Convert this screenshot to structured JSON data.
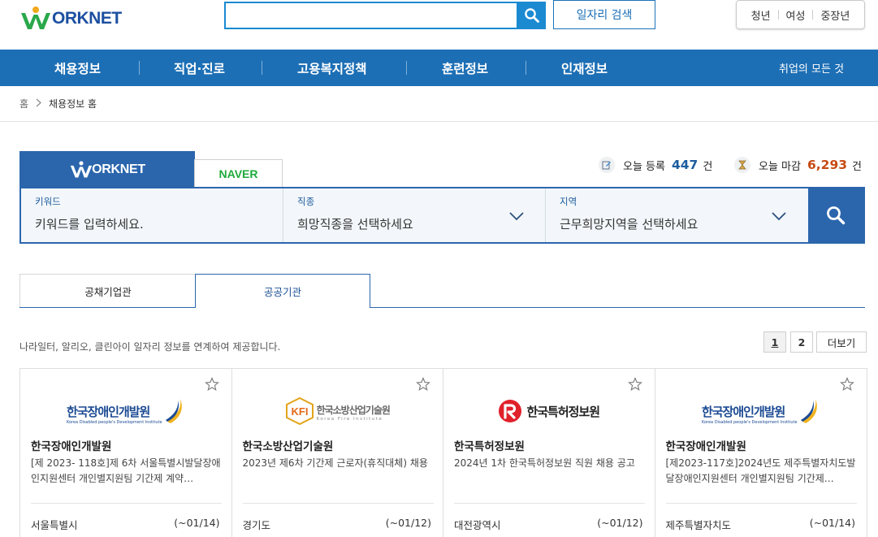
{
  "header": {
    "logo_text": "ORKNET",
    "search_placeholder": "",
    "job_search_label": "일자리 검색",
    "personas": [
      "청년",
      "여성",
      "중장년"
    ]
  },
  "nav": {
    "items": [
      "채용정보",
      "직업·진로",
      "고용복지정책",
      "훈련정보",
      "인재정보"
    ],
    "right_link": "취업의 모든 것"
  },
  "breadcrumb": {
    "home": "홈",
    "current": "채용정보 홈"
  },
  "search_tabs": {
    "worknet": "ORKNET",
    "naver": "NAVER"
  },
  "stats": {
    "today_registered_label": "오늘 등록",
    "today_registered_count": "447",
    "today_closing_label": "오늘 마감",
    "today_closing_count": "6,293",
    "unit": "건"
  },
  "search_panel": {
    "keyword": {
      "label": "키워드",
      "placeholder": "키워드를 입력하세요."
    },
    "job_type": {
      "label": "직종",
      "value": "희망직종을 선택하세요"
    },
    "region": {
      "label": "지역",
      "value": "근무희망지역을 선택하세요"
    }
  },
  "content_tabs": [
    "공채기업관",
    "공공기관"
  ],
  "description": "나라일터, 알리오, 클린아이 일자리 정보를 연계하여 제공합니다.",
  "pagination": {
    "pages": [
      "1",
      "2"
    ],
    "active": "1",
    "more_label": "더보기"
  },
  "cards": [
    {
      "logo": "한국장애인개발원",
      "logo_sub": "Korea Disabled people's Development Institute",
      "org": "한국장애인개발원",
      "title": "[제 2023- 118호]제 6차 서울특별시발달장애인지원센터 개인별지원팀 기간제 계약…",
      "region": "서울특별시",
      "date": "(~01/14)"
    },
    {
      "logo": "한국소방산업기술원",
      "logo_sub": "Korea Fire Institute",
      "logo_mark": "KFI",
      "org": "한국소방산업기술원",
      "title": "2023년 제6차 기간제 근로자(휴직대체) 채용",
      "region": "경기도",
      "date": "(~01/12)"
    },
    {
      "logo": "한국특허정보원",
      "org": "한국특허정보원",
      "title": "2024년 1차 한국특허정보원 직원 채용 공고",
      "region": "대전광역시",
      "date": "(~01/12)"
    },
    {
      "logo": "한국장애인개발원",
      "logo_sub": "Korea Disabled people's Development Institute",
      "org": "한국장애인개발원",
      "title": "[제2023-117호]2024년도 제주특별자치도발달장애인지원센터 개인별지원팀 기간제…",
      "region": "제주특별자치도",
      "date": "(~01/14)"
    }
  ],
  "colors": {
    "nav_bg": "#1d6fb5",
    "worknet_tab": "#2b66ad",
    "search_accent": "#1b8ad1",
    "stat_blue": "#1c5d9e",
    "stat_orange": "#c74a12",
    "naver_green": "#1faa3c"
  }
}
